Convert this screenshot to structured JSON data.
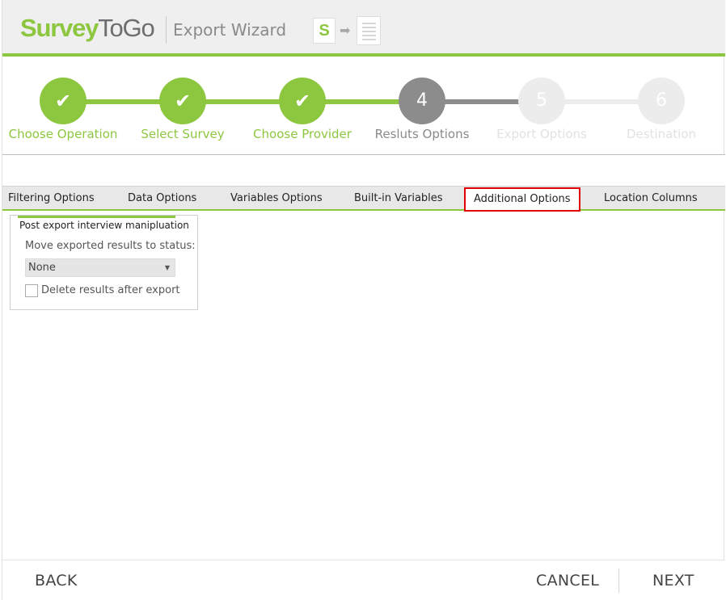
{
  "header": {
    "logo_part1": "Survey",
    "logo_part2": "ToGo",
    "title": "Export Wizard",
    "icon_s_glyph": "S",
    "icon_arrow_glyph": "➡"
  },
  "colors": {
    "accent": "#8dc63f",
    "current": "#8c8c8c",
    "future": "#ececec",
    "highlight": "#e00000"
  },
  "wizard": {
    "steps": [
      {
        "label": "Choose Operation",
        "marker": "✔",
        "state": "done"
      },
      {
        "label": "Select Survey",
        "marker": "✔",
        "state": "done"
      },
      {
        "label": "Choose Provider",
        "marker": "✔",
        "state": "done"
      },
      {
        "label": "Resluts Options",
        "marker": "4",
        "state": "current"
      },
      {
        "label": "Export Options",
        "marker": "5",
        "state": "future"
      },
      {
        "label": "Destination",
        "marker": "6",
        "state": "future"
      }
    ]
  },
  "tabs": [
    {
      "label": "Filtering Options"
    },
    {
      "label": "Data Options"
    },
    {
      "label": "Variables Options"
    },
    {
      "label": "Built-in Variables"
    },
    {
      "label": "Additional Options",
      "active": true
    },
    {
      "label": "Location Columns"
    }
  ],
  "panel": {
    "group_title": "Post export interview manipluation",
    "status_label": "Move exported results to status:",
    "status_value": "None",
    "status_caret": "▼",
    "delete_label": "Delete results after export",
    "delete_checked": false
  },
  "footer": {
    "back": "BACK",
    "cancel": "CANCEL",
    "next": "NEXT"
  }
}
